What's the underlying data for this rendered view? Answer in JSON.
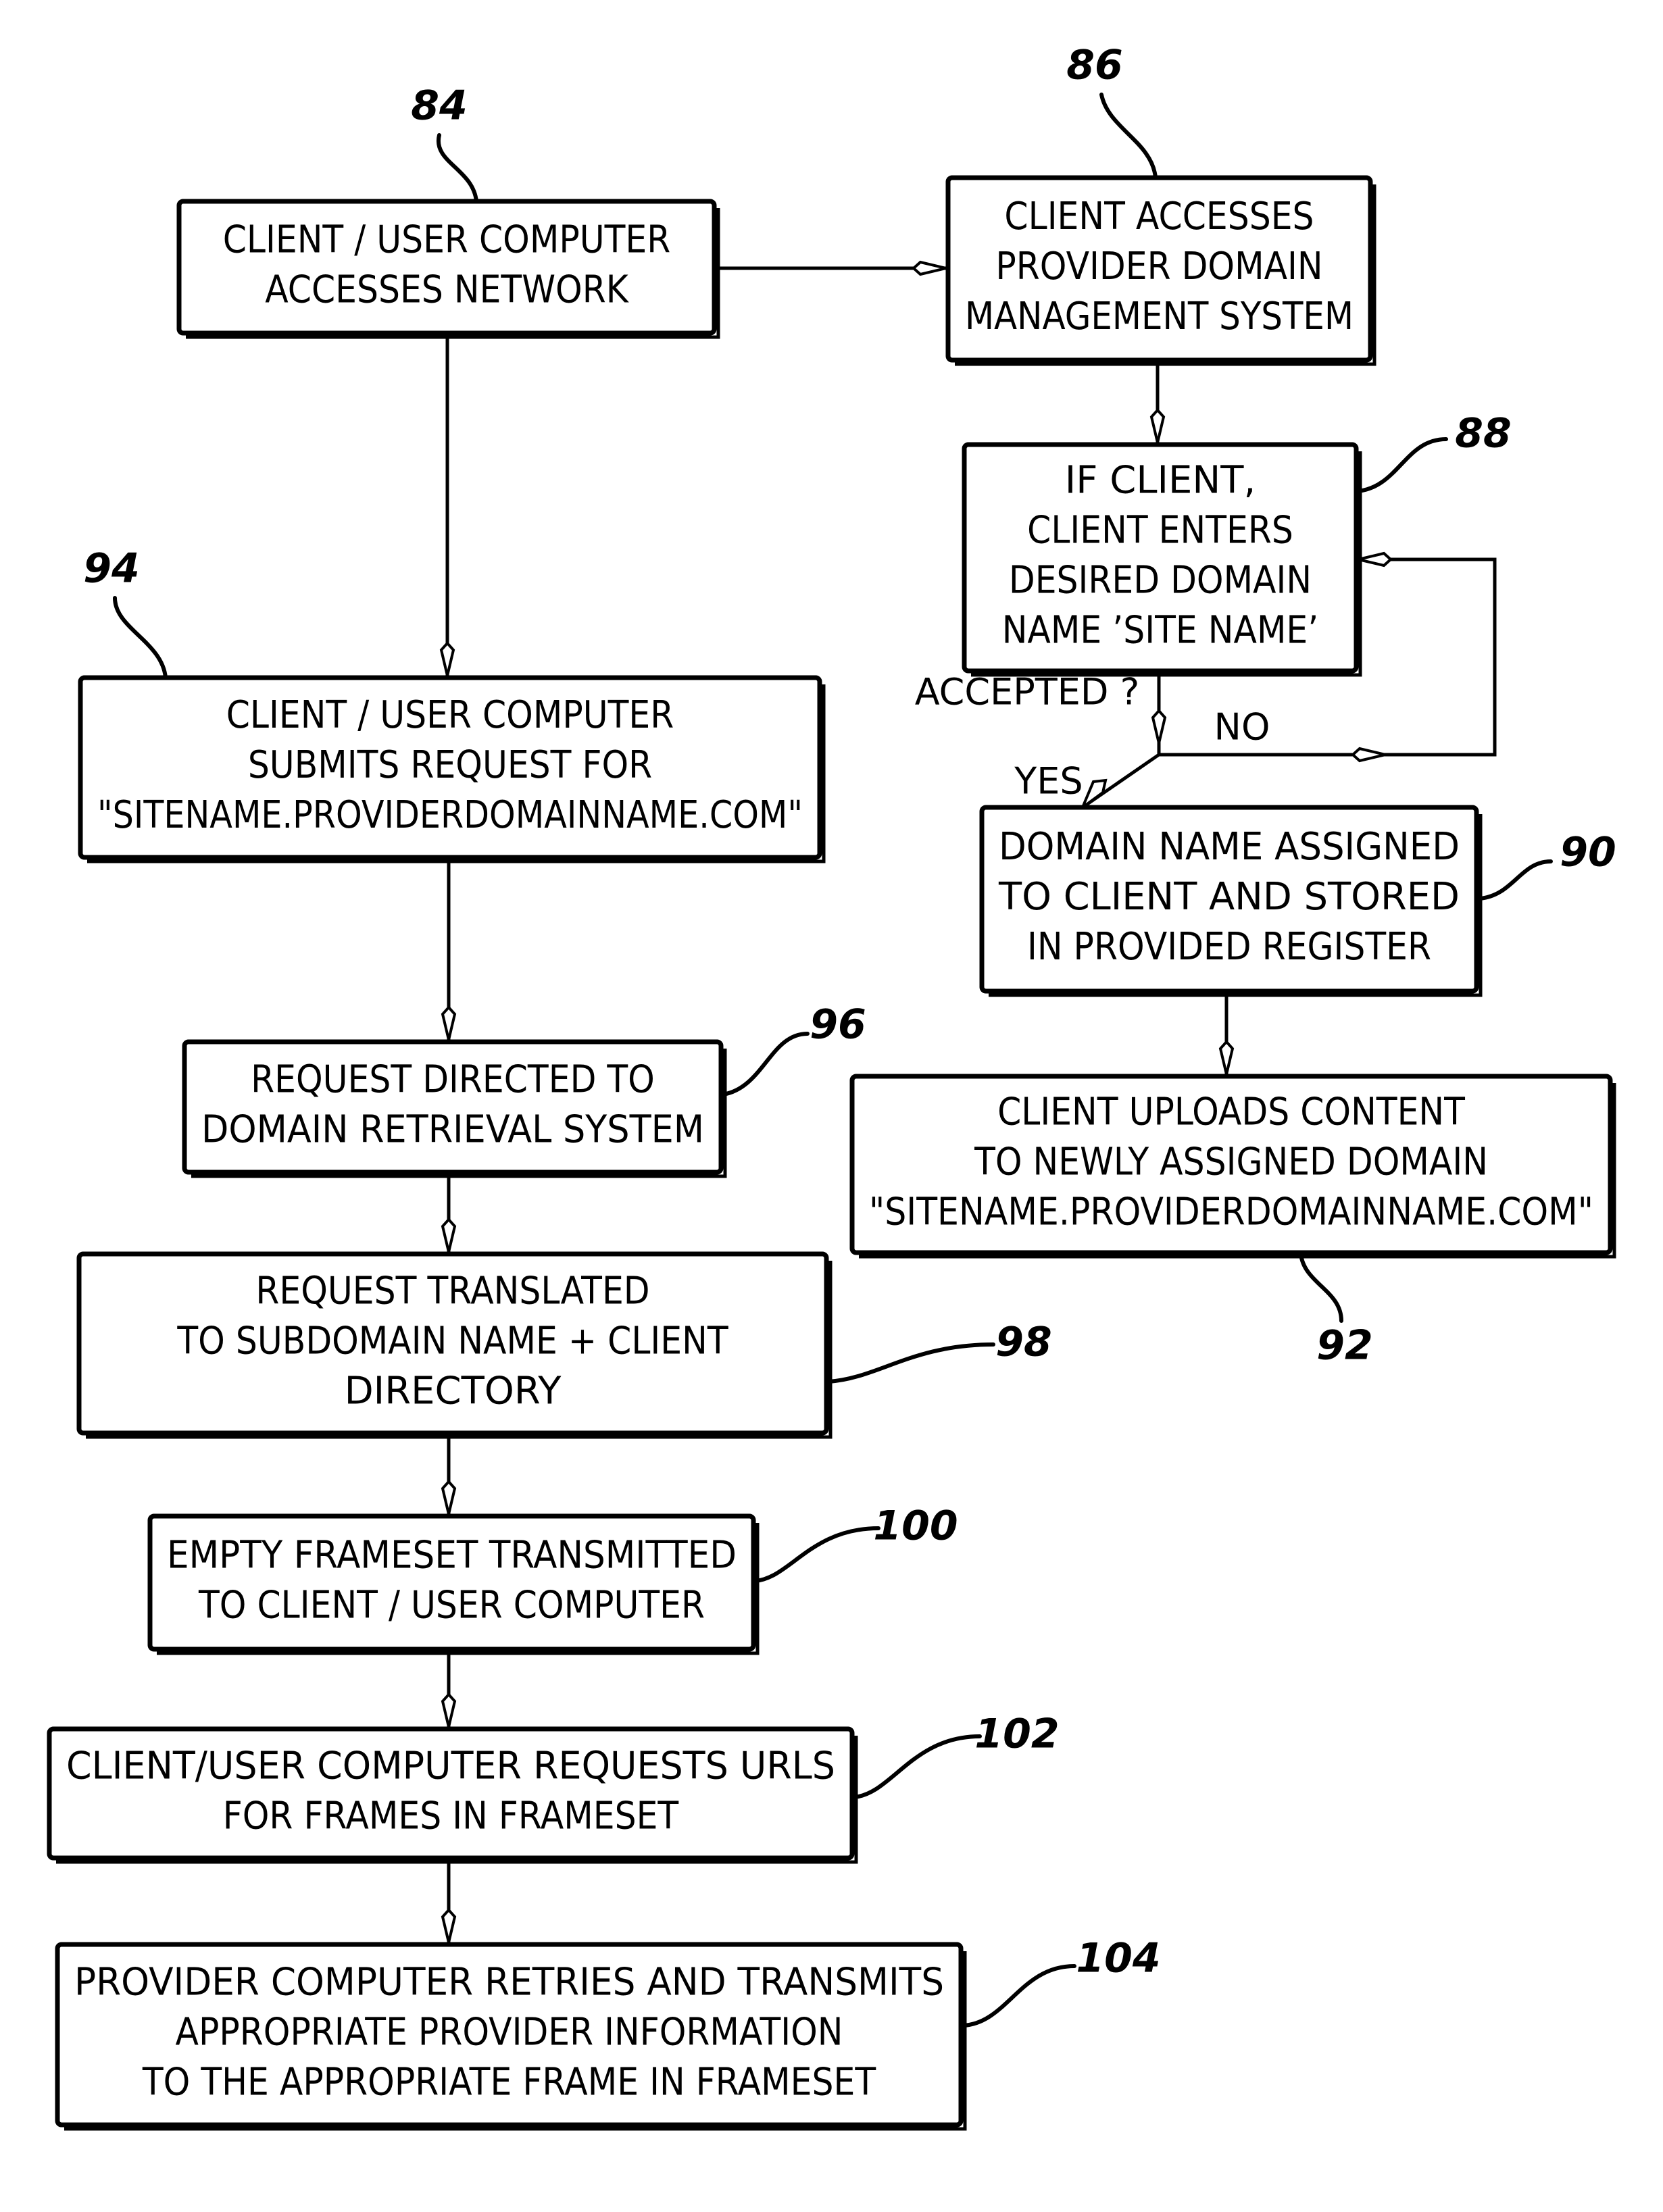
{
  "diagram": {
    "type": "flowchart",
    "colors": {
      "ink": "#000000",
      "paper": "#ffffff"
    },
    "steps": [
      {
        "ref": "84",
        "lines": [
          "CLIENT / USER COMPUTER",
          "ACCESSES NETWORK"
        ]
      },
      {
        "ref": "86",
        "lines": [
          "CLIENT ACCESSES",
          "PROVIDER DOMAIN",
          "MANAGEMENT SYSTEM"
        ]
      },
      {
        "ref": "88",
        "lines": [
          "IF CLIENT,",
          "CLIENT ENTERS",
          "DESIRED DOMAIN",
          "NAME ’SITE NAME’"
        ]
      },
      {
        "ref": "90",
        "lines": [
          "DOMAIN NAME ASSIGNED",
          "TO CLIENT AND STORED",
          "IN PROVIDED REGISTER"
        ]
      },
      {
        "ref": "92",
        "lines": [
          "CLIENT UPLOADS CONTENT",
          "TO NEWLY ASSIGNED DOMAIN",
          "\"SITENAME.PROVIDERDOMAINNAME.COM\""
        ]
      },
      {
        "ref": "94",
        "lines": [
          "CLIENT / USER COMPUTER",
          "SUBMITS REQUEST FOR",
          "\"SITENAME.PROVIDERDOMAINNAME.COM\""
        ]
      },
      {
        "ref": "96",
        "lines": [
          "REQUEST DIRECTED TO",
          "DOMAIN RETRIEVAL SYSTEM"
        ]
      },
      {
        "ref": "98",
        "lines": [
          "REQUEST TRANSLATED",
          "TO SUBDOMAIN NAME + CLIENT",
          "DIRECTORY"
        ]
      },
      {
        "ref": "100",
        "lines": [
          "EMPTY FRAMESET TRANSMITTED",
          "TO CLIENT / USER COMPUTER"
        ]
      },
      {
        "ref": "102",
        "lines": [
          "CLIENT/USER COMPUTER REQUESTS URLS",
          "FOR FRAMES IN FRAMESET"
        ]
      },
      {
        "ref": "104",
        "lines": [
          "PROVIDER COMPUTER RETRIES AND TRANSMITS",
          "APPROPRIATE PROVIDER INFORMATION",
          "TO THE APPROPRIATE FRAME IN FRAMESET"
        ]
      }
    ],
    "decision": {
      "question": "ACCEPTED ?",
      "yes": "YES",
      "no": "NO"
    },
    "edges": [
      {
        "from": "84",
        "to": "86"
      },
      {
        "from": "84",
        "to": "94"
      },
      {
        "from": "86",
        "to": "88"
      },
      {
        "from": "88",
        "to": "90",
        "label": "YES"
      },
      {
        "from": "88",
        "to": "88",
        "label": "NO"
      },
      {
        "from": "90",
        "to": "92"
      },
      {
        "from": "94",
        "to": "96"
      },
      {
        "from": "96",
        "to": "98"
      },
      {
        "from": "98",
        "to": "100"
      },
      {
        "from": "100",
        "to": "102"
      },
      {
        "from": "102",
        "to": "104"
      }
    ]
  }
}
